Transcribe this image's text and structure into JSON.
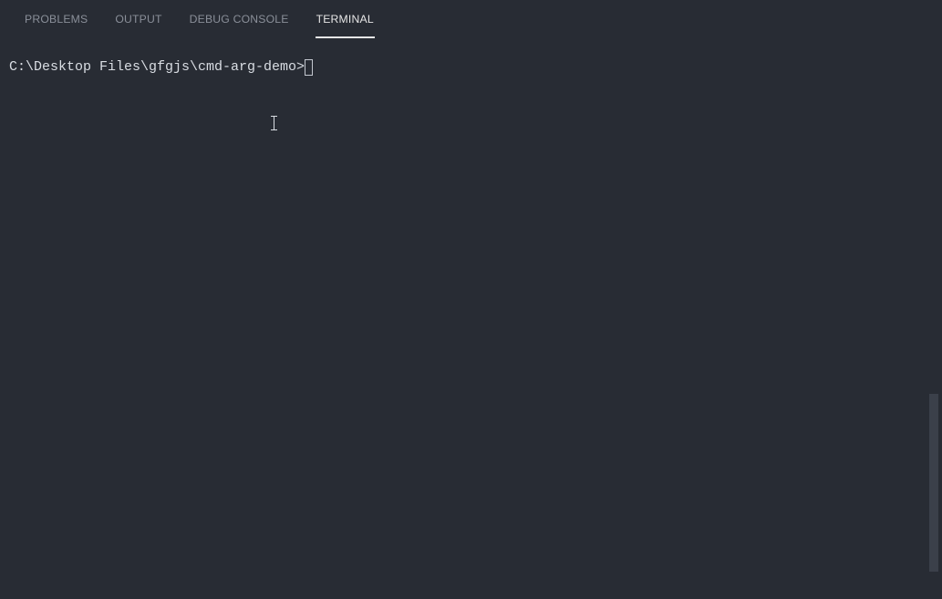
{
  "tabs": {
    "problems": "PROBLEMS",
    "output": "OUTPUT",
    "debug_console": "DEBUG CONSOLE",
    "terminal": "TERMINAL"
  },
  "active_tab": "terminal",
  "terminal": {
    "prompt": "C:\\Desktop Files\\gfgjs\\cmd-arg-demo>"
  }
}
